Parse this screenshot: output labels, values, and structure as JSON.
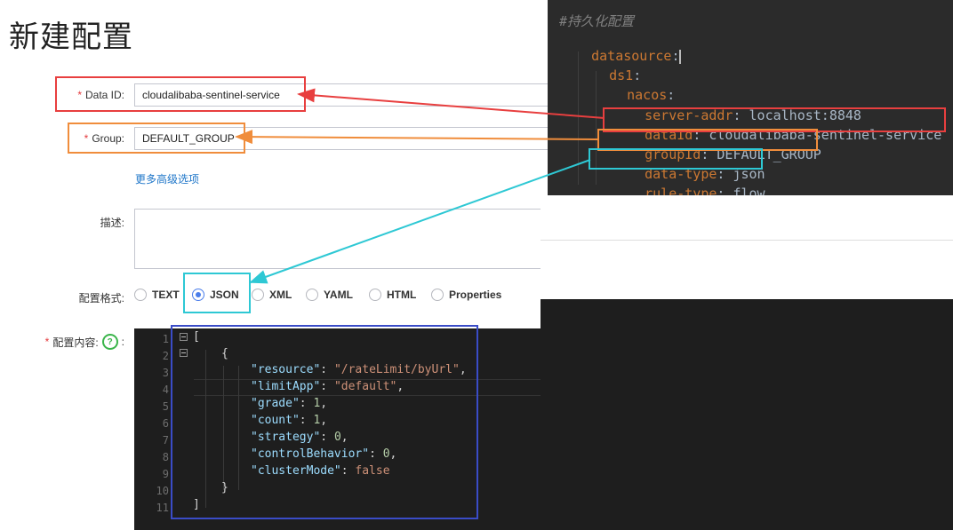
{
  "form": {
    "title": "新建配置",
    "data_id": {
      "label": "Data ID:",
      "value": "cloudalibaba-sentinel-service"
    },
    "group": {
      "label": "Group:",
      "value": "DEFAULT_GROUP"
    },
    "advanced_link": "更多高级选项",
    "description_label": "描述:",
    "format_label": "配置格式:",
    "formats": [
      "TEXT",
      "JSON",
      "XML",
      "YAML",
      "HTML",
      "Properties"
    ],
    "selected_format": "JSON",
    "content_label": "配置内容:",
    "help_icon": "?",
    "content_colon": ":"
  },
  "json_editor": {
    "line_numbers": [
      "1",
      "2",
      "3",
      "4",
      "5",
      "6",
      "7",
      "8",
      "9",
      "10",
      "11"
    ],
    "lines": {
      "l1": "[",
      "l2": "{",
      "resource_key": "\"resource\"",
      "resource_val": "\"/rateLimit/byUrl\"",
      "limitApp_key": "\"limitApp\"",
      "limitApp_val": "\"default\"",
      "grade_key": "\"grade\"",
      "grade_val": "1",
      "count_key": "\"count\"",
      "count_val": "1",
      "strategy_key": "\"strategy\"",
      "strategy_val": "0",
      "controlBehavior_key": "\"controlBehavior\"",
      "controlBehavior_val": "0",
      "clusterMode_key": "\"clusterMode\"",
      "clusterMode_val": "false",
      "l10": "}",
      "l11": "]"
    }
  },
  "yaml_editor": {
    "comment": "#持久化配置",
    "datasource": "datasource",
    "ds1": "ds1",
    "nacos": "nacos",
    "server_addr_key": "server-addr",
    "server_addr_val": "localhost:8848",
    "dataId_key": "dataId",
    "dataId_val": "cloudalibaba-sentinel-service",
    "groupId_key": "groupId",
    "groupId_val": "DEFAULT_GROUP",
    "data_type_key": "data-type",
    "data_type_val": "json",
    "rule_type_key": "rule-type",
    "rule_type_val": "flow",
    "colon": ":"
  },
  "colors": {
    "red": "#e83f3f",
    "orange": "#f08d3c",
    "cyan": "#2ec8d4",
    "blue": "#3a4cc7",
    "link": "#2077c9",
    "radio_checked": "#4a7dea"
  }
}
